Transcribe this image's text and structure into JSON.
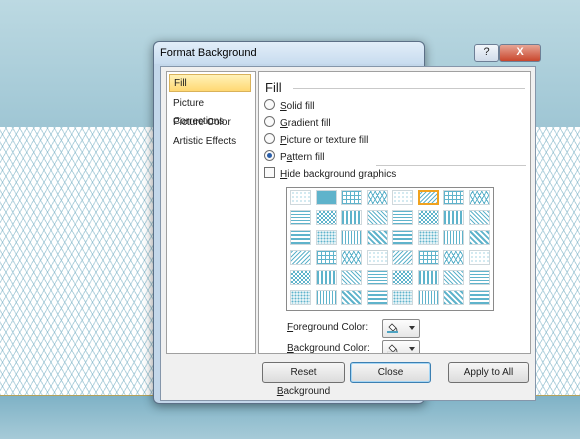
{
  "dialog": {
    "title": "Format Background",
    "help_glyph": "?",
    "close_glyph": "X"
  },
  "nav": {
    "items": [
      {
        "label": "Fill",
        "selected": true
      },
      {
        "label": "Picture Corrections",
        "selected": false
      },
      {
        "label": "Picture Color",
        "selected": false
      },
      {
        "label": "Artistic Effects",
        "selected": false
      }
    ]
  },
  "fill": {
    "heading": "Fill",
    "options": [
      {
        "label": "Solid fill",
        "accel": "S",
        "rest": "olid fill",
        "checked": false
      },
      {
        "label": "Gradient fill",
        "accel": "G",
        "rest": "radient fill",
        "checked": false
      },
      {
        "label": "Picture or texture fill",
        "accel": "P",
        "rest": "icture or texture fill",
        "checked": false
      },
      {
        "label": "Pattern fill",
        "pre": "P",
        "accel": "a",
        "rest": "ttern fill",
        "checked": true
      }
    ],
    "hide_graphics": {
      "label": "Hide background graphics",
      "accel": "H",
      "rest": "ide background graphics",
      "checked": false
    },
    "pattern_grid": {
      "rows": 6,
      "cols": 8,
      "selected_row": 0,
      "selected_col": 5,
      "pattern_color": "#5fb3cb"
    },
    "foreground_color": {
      "label": "Foreground Color:",
      "accel": "F",
      "rest": "oreground Color:",
      "icon": "paint-bucket-icon",
      "swatch": "#4da3c2"
    },
    "background_color": {
      "label": "Background Color:",
      "accel": "B",
      "rest": "ackground Color:",
      "icon": "paint-bucket-icon",
      "swatch": "#ffffff"
    }
  },
  "buttons": {
    "reset_pre": "Reset ",
    "reset_accel": "B",
    "reset_rest": "ackground",
    "close": "Close",
    "apply_all": "Apply to All"
  },
  "colors": {
    "accent_selected": "#ffd873",
    "pattern": "#5fb3cb"
  }
}
